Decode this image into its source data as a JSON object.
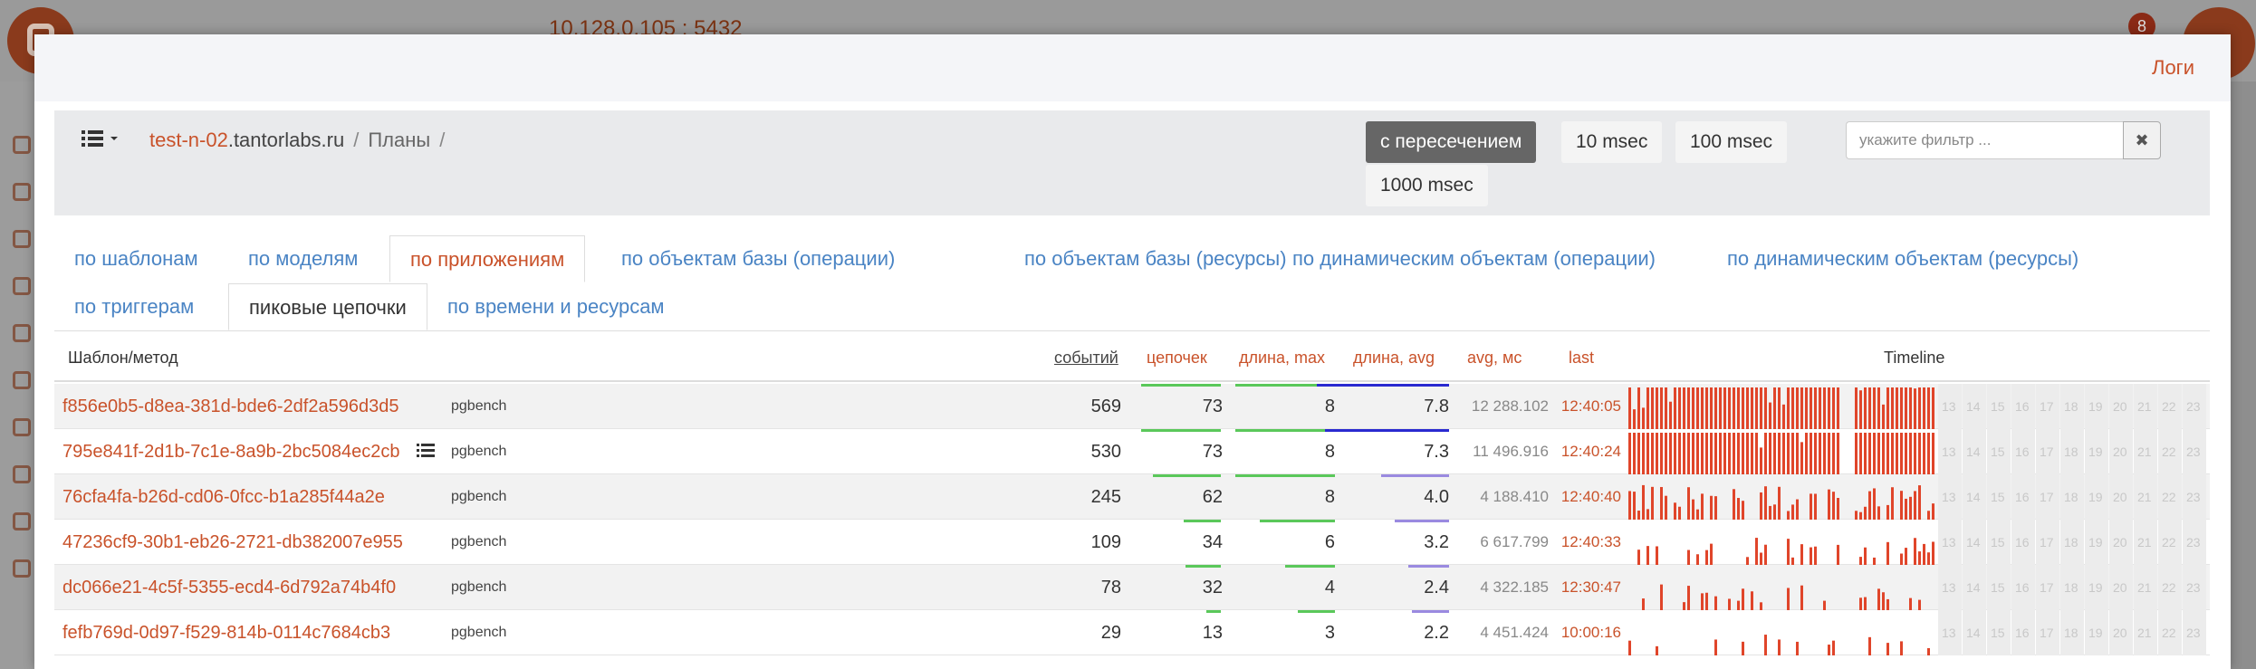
{
  "backdrop": {
    "ip": "10.128.0.105 : 5432",
    "badge": "8"
  },
  "modal": {
    "logs_label": "Логи"
  },
  "breadcrumb": {
    "host_highlight": "test-n-02",
    "host_rest": ".tantorlabs.ru",
    "sep": "/",
    "section": "Планы"
  },
  "segments": {
    "overlap": "с пересечением",
    "s10": "10 msec",
    "s100": "100 msec",
    "s1000": "1000 msec"
  },
  "filter": {
    "placeholder": "укажите фильтр ...",
    "clear": "✖"
  },
  "tabs": [
    "по шаблонам",
    "по моделям",
    "по приложениям",
    "по объектам базы (операции)",
    "по объектам базы (ресурсы)",
    "по динамическим объектам (операции)",
    "по динамическим объектам (ресурсы)",
    "по триггерам",
    "пиковые цепочки",
    "по времени и ресурсам"
  ],
  "table": {
    "headers": {
      "name": "Шаблон/метод",
      "events": "событий",
      "chains": "цепочек",
      "len_max": "длина, max",
      "len_avg": "длина, avg",
      "avg_ms": "avg, мс",
      "last": "last",
      "timeline": "Timeline"
    },
    "rows": [
      {
        "name": "f856e0b5-d8ea-381d-bde6-2df2a596d3d5",
        "app": "pgbench",
        "events": "569",
        "chains": "73",
        "len_max": "8",
        "len_avg": "7.8",
        "avg_ms": "12 288.102",
        "last": "12:40:05"
      },
      {
        "name": "795e841f-2d1b-7c1e-8a9b-2bc5084ec2cb",
        "app": "pgbench",
        "events": "530",
        "chains": "73",
        "len_max": "8",
        "len_avg": "7.3",
        "avg_ms": "11 496.916",
        "last": "12:40:24"
      },
      {
        "name": "76cfa4fa-b26d-cd06-0fcc-b1a285f44a2e",
        "app": "pgbench",
        "events": "245",
        "chains": "62",
        "len_max": "8",
        "len_avg": "4.0",
        "avg_ms": "4 188.410",
        "last": "12:40:40"
      },
      {
        "name": "47236cf9-30b1-eb26-2721-db382007e955",
        "app": "pgbench",
        "events": "109",
        "chains": "34",
        "len_max": "6",
        "len_avg": "3.2",
        "avg_ms": "6 617.799",
        "last": "12:40:33"
      },
      {
        "name": "dc066e21-4c5f-5355-ecd4-6d792a74b4f0",
        "app": "pgbench",
        "events": "78",
        "chains": "32",
        "len_max": "4",
        "len_avg": "2.4",
        "avg_ms": "4 322.185",
        "last": "12:30:47"
      },
      {
        "name": "fefb769d-0d97-f529-814b-0114c7684cb3",
        "app": "pgbench",
        "events": "29",
        "chains": "13",
        "len_max": "3",
        "len_avg": "2.2",
        "avg_ms": "4 451.424",
        "last": "10:00:16"
      }
    ],
    "timeline_hours": [
      "13",
      "14",
      "15",
      "16",
      "17",
      "18",
      "19",
      "20",
      "21",
      "22",
      "23"
    ]
  },
  "colors": {
    "accent": "#c9522a",
    "link": "#4a84c4",
    "bar_green": "#5ac85a",
    "bar_blue": "#2a2ad0",
    "bar_purple": "#9a8ae0",
    "timeline_bar": "#e0452a"
  }
}
